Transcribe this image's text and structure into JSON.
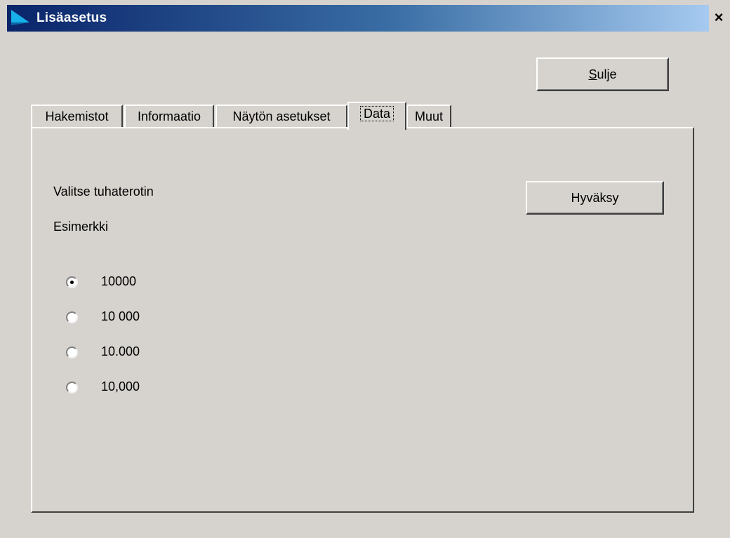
{
  "window": {
    "title": "Lisäasetus",
    "close_glyph": "×",
    "icon": "app-arrow-icon"
  },
  "close_button": {
    "label_accel": "S",
    "label_rest": "ulje"
  },
  "tabs": [
    {
      "label": "Hakemistot",
      "active": false
    },
    {
      "label": "Informaatio",
      "active": false
    },
    {
      "label": "Näytön asetukset",
      "active": false
    },
    {
      "label": "Data",
      "active": true
    },
    {
      "label": "Muut",
      "active": false
    }
  ],
  "data_tab": {
    "prompt": "Valitse tuhaterotin",
    "example_label": "Esimerkki",
    "accept_label": "Hyväksy",
    "options": [
      {
        "label": "10000",
        "checked": true
      },
      {
        "label": "10 000",
        "checked": false
      },
      {
        "label": "10.000",
        "checked": false
      },
      {
        "label": "10,000",
        "checked": false
      }
    ]
  },
  "colors": {
    "face": "#d6d3ce",
    "titlebar_start": "#0a246a",
    "titlebar_end": "#a6caf0",
    "title_text": "#ffffff"
  }
}
